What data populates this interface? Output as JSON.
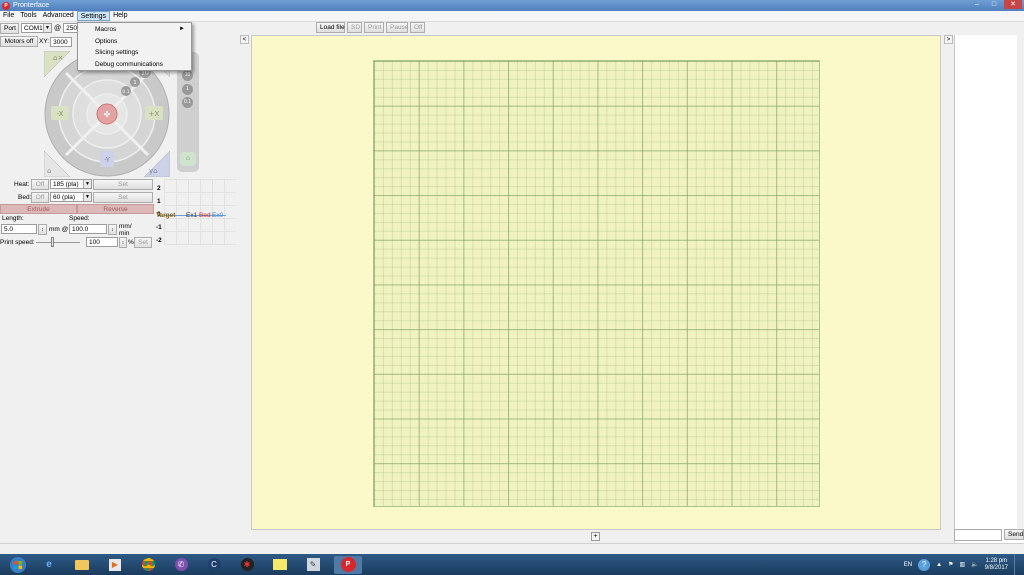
{
  "window": {
    "title": "Pronterface"
  },
  "menubar": {
    "items": [
      "File",
      "Tools",
      "Advanced",
      "Settings",
      "Help"
    ],
    "active": "Settings"
  },
  "settings_menu": {
    "items": [
      "Macros",
      "Options",
      "Slicing settings",
      "Debug communications"
    ]
  },
  "connection": {
    "port_button": "Port",
    "port_value": "COM1",
    "at": "@",
    "baud_value": "250000"
  },
  "motors": {
    "motors_off_label": "Motors off",
    "xy_label": "XY:",
    "xy_value": "3000",
    "z_label": "Z:"
  },
  "jog": {
    "steps": [
      "10",
      "1",
      "0.1"
    ],
    "z_steps": [
      "10",
      "1",
      "0.1"
    ],
    "x_minus": "-X",
    "x_plus": "+X",
    "y_minus": "-Y",
    "y_plus": "Y"
  },
  "temps": {
    "heat_label": "Heat:",
    "heat_off": "Off",
    "heat_value": "185 (pla)",
    "heat_set": "Set",
    "bed_label": "Bed:",
    "bed_off": "Off",
    "bed_value": "60 (pla)",
    "bed_set": "Set"
  },
  "extrude": {
    "extrude_label": "Extrude",
    "reverse_label": "Reverse"
  },
  "length_speed": {
    "length_label": "Length:",
    "length_value": "5.0",
    "mm_at": "mm @",
    "speed_label": "Speed:",
    "speed_value": "100.0",
    "speed_unit": "mm/ min"
  },
  "print_speed": {
    "label": "Print speed:",
    "value": "100",
    "unit": "%",
    "set": "Set"
  },
  "temp_graph": {
    "ticks": [
      "2",
      "1",
      "0",
      "-1",
      "-2"
    ],
    "legend": [
      "Target",
      "Ex1",
      "Bed",
      "Ex0"
    ],
    "legend_colors": [
      "#8a5a00",
      "#333333",
      "#c82020",
      "#3a7fd0"
    ]
  },
  "toolbar": {
    "load_file": "Load file",
    "sd": "SD",
    "print": "Print",
    "pause": "Pause",
    "off": "Off"
  },
  "collapse": {
    "left": "<",
    "right": ">"
  },
  "console": {
    "send_label": "Send"
  },
  "tray": {
    "lang": "EN",
    "time": "1:28 pm",
    "date": "9/8/2017"
  }
}
